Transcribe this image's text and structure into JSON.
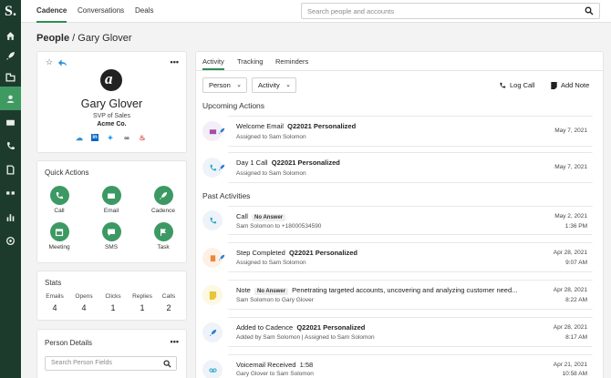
{
  "colors": {
    "rail": "#1d3b2c",
    "accent": "#3d9963",
    "active_rail": "#3f9a62"
  },
  "rail": {
    "logo": "S.",
    "icons": [
      "home-icon",
      "rocket-icon",
      "building-icon",
      "person-icon",
      "mail-icon",
      "phone-icon",
      "document-icon",
      "quote-icon",
      "chart-icon",
      "target-icon"
    ]
  },
  "topnav": {
    "tabs": [
      "Cadence",
      "Conversations",
      "Deals"
    ],
    "active": "Cadence"
  },
  "search": {
    "placeholder": "Search people and accounts"
  },
  "breadcrumb": {
    "root": "People",
    "separator": "/",
    "current": "Gary Glover"
  },
  "profile": {
    "name": "Gary Glover",
    "title": "SVP of Sales",
    "company": "Acme Co.",
    "more": "•••"
  },
  "quick_actions": {
    "title": "Quick Actions",
    "items": [
      {
        "label": "Call",
        "icon": "phone-icon"
      },
      {
        "label": "Email",
        "icon": "mail-icon"
      },
      {
        "label": "Cadence",
        "icon": "rocket-icon"
      },
      {
        "label": "Meeting",
        "icon": "calendar-icon"
      },
      {
        "label": "SMS",
        "icon": "chat-icon"
      },
      {
        "label": "Task",
        "icon": "flag-icon"
      }
    ]
  },
  "stats": {
    "title": "Stats",
    "items": [
      {
        "label": "Emails",
        "value": "4"
      },
      {
        "label": "Opens",
        "value": "4"
      },
      {
        "label": "Clicks",
        "value": "1"
      },
      {
        "label": "Replies",
        "value": "1"
      },
      {
        "label": "Calls",
        "value": "2"
      }
    ]
  },
  "person_details": {
    "title": "Person Details",
    "more": "•••",
    "search_placeholder": "Search Person Fields"
  },
  "right": {
    "tabs": [
      "Activity",
      "Tracking",
      "Reminders"
    ],
    "filters": [
      "Person",
      "Activity"
    ],
    "log_call": "Log Call",
    "add_note": "Add Note",
    "upcoming_title": "Upcoming Actions",
    "past_title": "Past Activities",
    "upcoming": [
      {
        "title": "Welcome Email",
        "bold": "Q22021 Personalized",
        "sub": "Assigned to Sam Solomon",
        "date": "May 7, 2021"
      },
      {
        "title": "Day 1 Call",
        "bold": "Q22021 Personalized",
        "sub": "Assigned to Sam Solomon",
        "date": "May 7, 2021"
      }
    ],
    "past": [
      {
        "title": "Call",
        "pill": "No Answer",
        "sub": "Sam Solomon to +18000534590",
        "date": "May 2, 2021",
        "time": "1:36 PM"
      },
      {
        "title": "Step Completed",
        "bold": "Q22021 Personalized",
        "sub": "Assigned to Sam Solomon",
        "date": "Apr 28, 2021",
        "time": "9:07 AM"
      },
      {
        "title": "Note",
        "pill": "No Answer",
        "extra": "Penetrating targeted accounts, uncovering and analyzing customer need...",
        "sub": "Sam Solomon to Gary Glover",
        "date": "Apr 28, 2021",
        "time": "8:22 AM"
      },
      {
        "title": "Added to Cadence",
        "bold": "Q22021 Personalized",
        "sub": "Added by Sam Solomon | Assigned to Sam Solomon",
        "date": "Apr 28, 2021",
        "time": "8:17 AM"
      },
      {
        "title": "Voicemail Received",
        "extra": "1:58",
        "sub": "Gary Glover to Sam Solomon",
        "date": "Apr 21, 2021",
        "time": "10:58 AM"
      }
    ]
  }
}
